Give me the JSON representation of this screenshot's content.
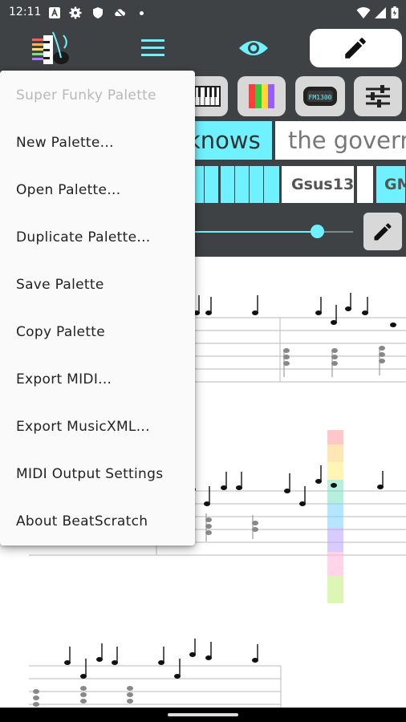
{
  "status_bar": {
    "time": "12:11",
    "icons": [
      "a-icon",
      "settings-icon",
      "shield-icon",
      "cloud-off-icon",
      "dot-icon",
      "wifi-icon",
      "signal-icon",
      "battery-icon"
    ]
  },
  "toolbar": {
    "logo": "beatscratch-logo",
    "menu_icon": "hamburger-icon",
    "view_icon": "eye-icon",
    "edit_icon": "pencil-icon"
  },
  "tools": {
    "icons": [
      "keyboard-icon",
      "color-bars-icon",
      "midi-synth-icon",
      "sliders-icon"
    ],
    "synth_label": "FM1300"
  },
  "lyrics": [
    "knows",
    "the governm"
  ],
  "chords": [
    "Gsus13",
    "GM"
  ],
  "slider": {
    "value": 0.78
  },
  "menu": {
    "header": "Super Funky Palette",
    "items": [
      "New Palette...",
      "Open Palette...",
      "Duplicate Palette...",
      "Save Palette",
      "Copy Palette",
      "Export MIDI...",
      "Export MusicXML...",
      "MIDI Output Settings",
      "About BeatScratch"
    ]
  },
  "colors": {
    "toolbar_bg": "#3e4244",
    "accent": "#6ff1ff",
    "menu_bg": "#fafafa",
    "button_bg": "#d8d8d8"
  }
}
